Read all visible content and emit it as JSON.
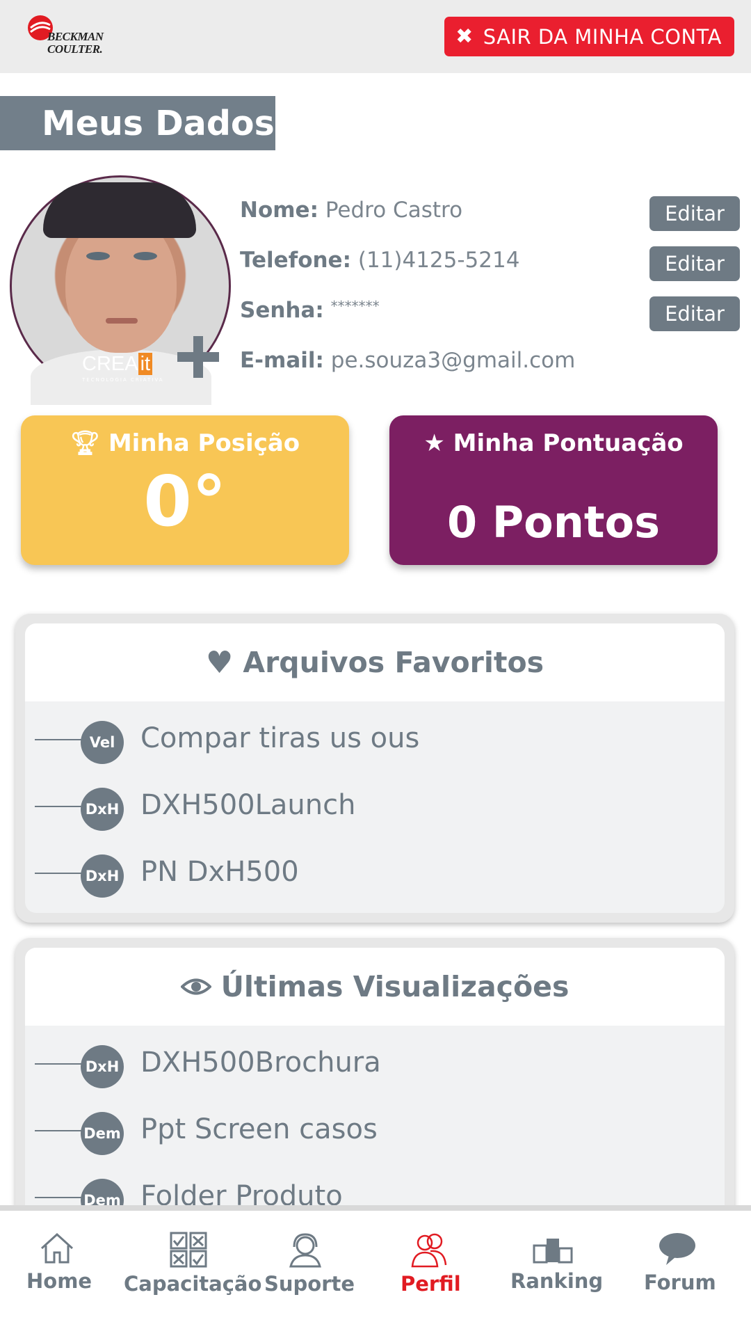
{
  "header": {
    "logo_text_line1": "BECKMAN",
    "logo_text_line2": "COULTER.",
    "logout_label": "SAIR DA MINHA CONTA",
    "logout_icon": "times-icon"
  },
  "page_title": "Meus Dados",
  "profile": {
    "avatar_watermark": "CREA",
    "avatar_watermark_it": "it",
    "avatar_watermark_sub": "TECNOLOGIA CRIATIVA",
    "fields": [
      {
        "label": "Nome:",
        "value": "Pedro Castro",
        "edit_label": "Editar"
      },
      {
        "label": "Telefone:",
        "value": "(11)4125-5214",
        "edit_label": "Editar"
      },
      {
        "label": "Senha:",
        "value": "*******",
        "edit_label": "Editar"
      },
      {
        "label": "E-mail:",
        "value": "pe.souza3@gmail.com"
      }
    ]
  },
  "stats": {
    "position": {
      "title": "Minha Posição",
      "value": "0°",
      "icon": "trophy-icon",
      "color": "#f8c655"
    },
    "score": {
      "title": "Minha Pontuação",
      "value": "0 Pontos",
      "icon": "star-icon",
      "color": "#7c1f62"
    }
  },
  "favorites": {
    "title": "Arquivos Favoritos",
    "icon": "heart-icon",
    "items": [
      {
        "badge": "Vel",
        "label": "Compar tiras us ous"
      },
      {
        "badge": "DxH",
        "label": "DXH500Launch"
      },
      {
        "badge": "DxH",
        "label": "PN DxH500"
      }
    ]
  },
  "recent": {
    "title": "Últimas Visualizações",
    "icon": "eye-icon",
    "items": [
      {
        "badge": "DxH",
        "label": "DXH500Brochura"
      },
      {
        "badge": "Dem",
        "label": "Ppt Screen casos"
      },
      {
        "badge": "Dem",
        "label": "Folder Produto"
      }
    ]
  },
  "nav": {
    "items": [
      {
        "label": "Home",
        "icon": "home-icon"
      },
      {
        "label": "Capacitação",
        "icon": "checklist-icon"
      },
      {
        "label": "Suporte",
        "icon": "headset-icon"
      },
      {
        "label": "Perfil",
        "icon": "users-icon",
        "active": true
      },
      {
        "label": "Ranking",
        "icon": "podium-icon"
      },
      {
        "label": "Forum",
        "icon": "chat-icon"
      }
    ],
    "active_color": "#e11b22"
  },
  "colors": {
    "accent_red": "#ea1f2f",
    "slate": "#6e7a84"
  }
}
